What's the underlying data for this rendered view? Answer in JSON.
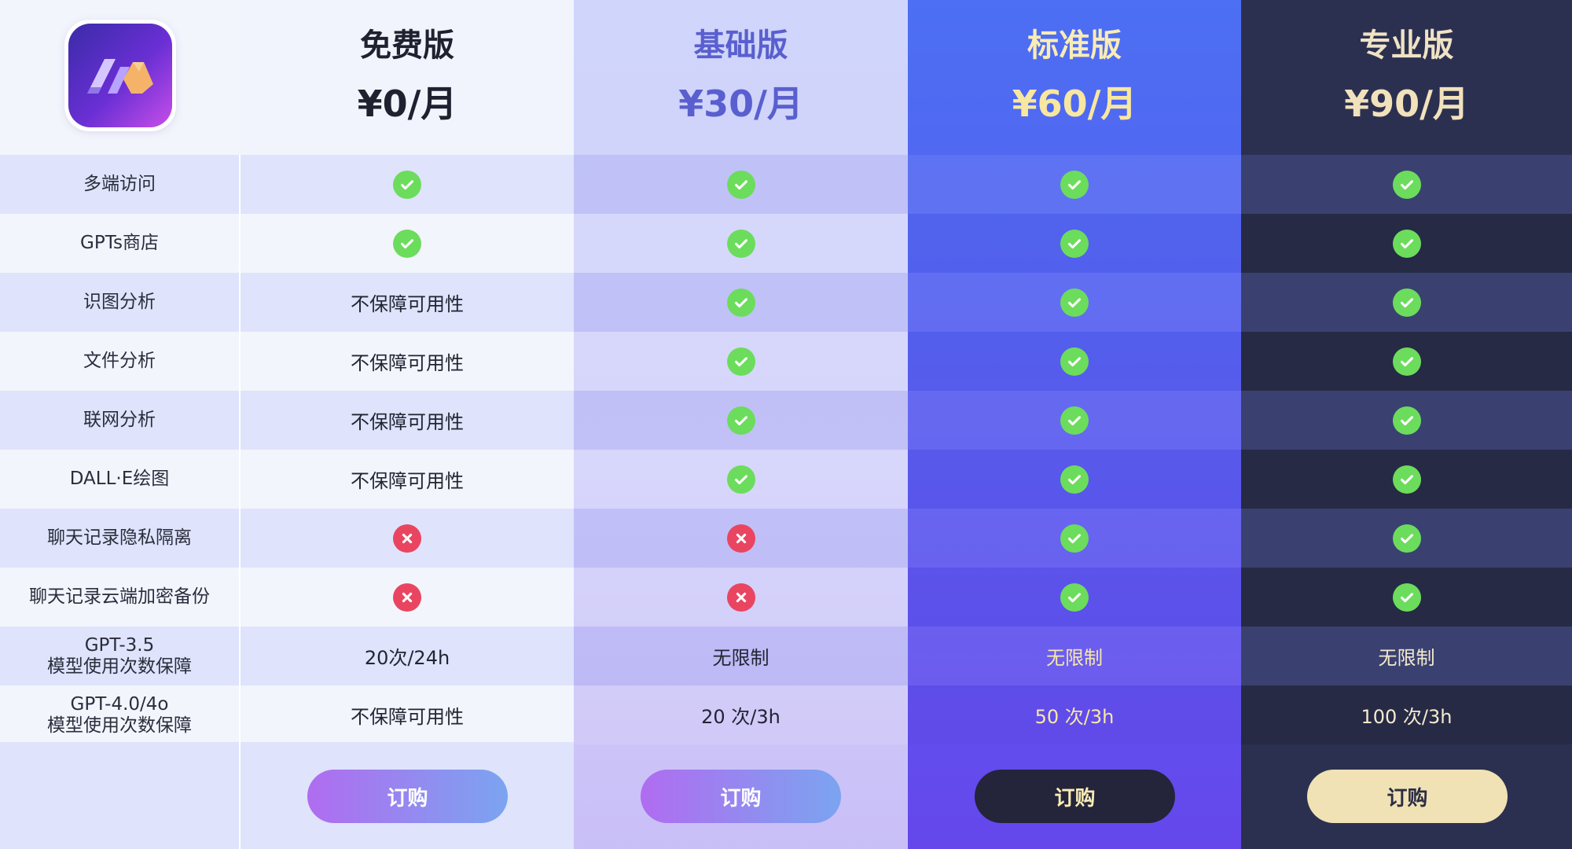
{
  "plans": [
    {
      "name": "免费版",
      "price": "¥0/月",
      "button": "订购"
    },
    {
      "name": "基础版",
      "price": "¥30/月",
      "button": "订购"
    },
    {
      "name": "标准版",
      "price": "¥60/月",
      "button": "订购"
    },
    {
      "name": "专业版",
      "price": "¥90/月",
      "button": "订购"
    }
  ],
  "features": [
    {
      "label": "多端访问",
      "values": [
        "check",
        "check",
        "check",
        "check"
      ]
    },
    {
      "label": "GPTs商店",
      "values": [
        "check",
        "check",
        "check",
        "check"
      ]
    },
    {
      "label": "识图分析",
      "values": [
        "不保障可用性",
        "check",
        "check",
        "check"
      ]
    },
    {
      "label": "文件分析",
      "values": [
        "不保障可用性",
        "check",
        "check",
        "check"
      ]
    },
    {
      "label": "联网分析",
      "values": [
        "不保障可用性",
        "check",
        "check",
        "check"
      ]
    },
    {
      "label": "DALL·E绘图",
      "values": [
        "不保障可用性",
        "check",
        "check",
        "check"
      ]
    },
    {
      "label": "聊天记录隐私隔离",
      "values": [
        "cross",
        "cross",
        "check",
        "check"
      ]
    },
    {
      "label": "聊天记录云端加密备份",
      "values": [
        "cross",
        "cross",
        "check",
        "check"
      ]
    },
    {
      "label_line1": "GPT-3.5",
      "label_line2": "模型使用次数保障",
      "values": [
        "20次/24h",
        "无限制",
        "无限制",
        "无限制"
      ]
    },
    {
      "label_line1": "GPT-4.0/4o",
      "label_line2": "模型使用次数保障",
      "values": [
        "不保障可用性",
        "20 次/3h",
        "50 次/3h",
        "100 次/3h"
      ]
    }
  ],
  "icons": {
    "check": "check-icon",
    "cross": "cross-icon",
    "logo": "app-logo-icon"
  },
  "colors": {
    "check": "#6cdc5c",
    "cross": "#e94561",
    "standard_accent": "#4c6ff3",
    "pro_bg": "#2c3050"
  }
}
